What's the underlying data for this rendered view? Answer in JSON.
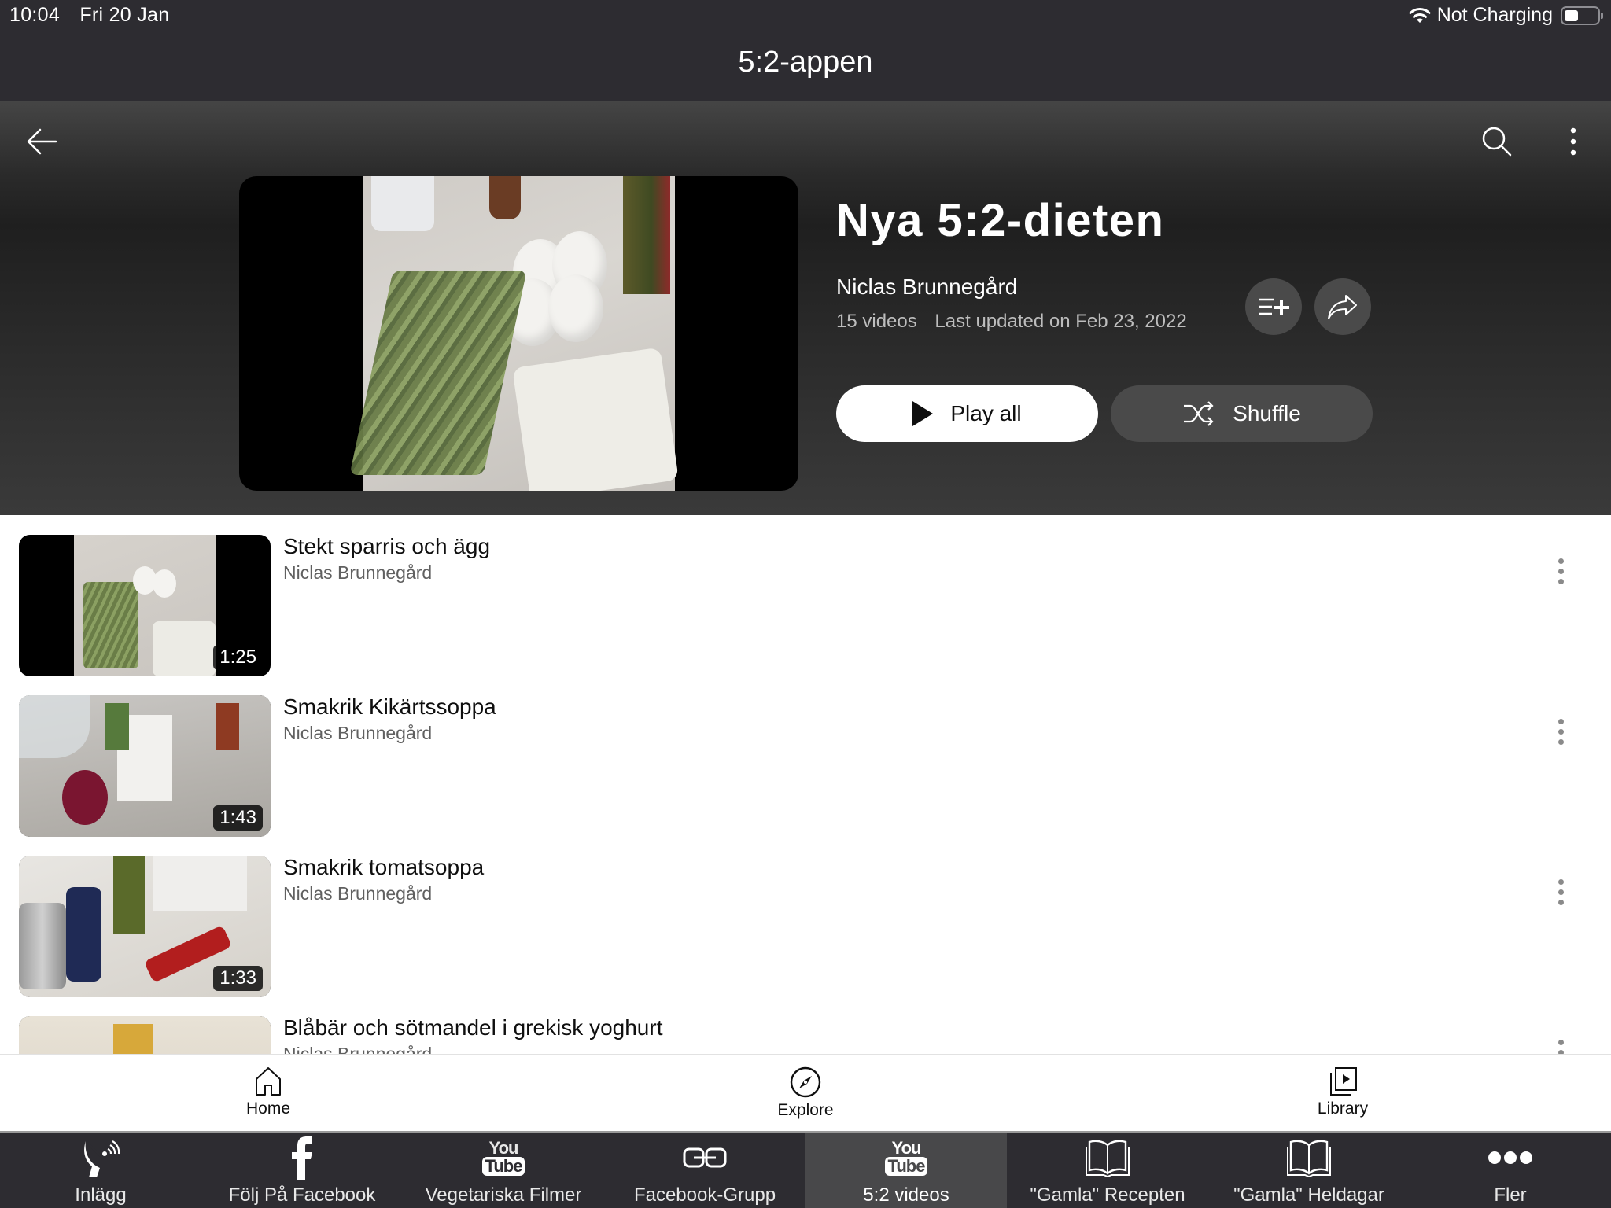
{
  "status_bar": {
    "time": "10:04",
    "date": "Fri 20 Jan",
    "charging": "Not Charging",
    "battery_level": 0.35
  },
  "app": {
    "title": "5:2-appen"
  },
  "header": {
    "back_icon": "arrow-left-icon",
    "search_icon": "search-icon",
    "more_icon": "more-vertical-icon"
  },
  "playlist": {
    "title": "Nya 5:2-dieten",
    "owner": "Niclas Brunnegård",
    "video_count": "15 videos",
    "last_updated": "Last updated on Feb 23, 2022",
    "save_icon": "playlist-add-icon",
    "share_icon": "share-icon",
    "play_all_label": "Play all",
    "shuffle_label": "Shuffle"
  },
  "videos": [
    {
      "title": "Stekt sparris och ägg",
      "channel": "Niclas Brunnegård",
      "duration": "1:25"
    },
    {
      "title": "Smakrik Kikärtssoppa",
      "channel": "Niclas Brunnegård",
      "duration": "1:43"
    },
    {
      "title": "Smakrik tomatsoppa",
      "channel": "Niclas Brunnegård",
      "duration": "1:33"
    },
    {
      "title": "Blåbär och sötmandel i grekisk yoghurt",
      "channel": "Niclas Brunnegård",
      "duration": ""
    }
  ],
  "youtube_nav": [
    {
      "label": "Home",
      "icon": "home-icon"
    },
    {
      "label": "Explore",
      "icon": "compass-icon"
    },
    {
      "label": "Library",
      "icon": "library-icon"
    }
  ],
  "tabs": [
    {
      "label": "Inlägg",
      "icon": "satellite-dish-icon",
      "active": false
    },
    {
      "label": "Följ På Facebook",
      "icon": "facebook-icon",
      "active": false
    },
    {
      "label": "Vegetariska Filmer",
      "icon": "youtube-icon",
      "active": false
    },
    {
      "label": "Facebook-Grupp",
      "icon": "link-icon",
      "active": false
    },
    {
      "label": "5:2 videos",
      "icon": "youtube-icon",
      "active": true
    },
    {
      "label": "\"Gamla\" Recepten",
      "icon": "book-icon",
      "active": false
    },
    {
      "label": "\"Gamla\" Heldagar",
      "icon": "book-icon",
      "active": false
    },
    {
      "label": "Fler",
      "icon": "more-horizontal-icon",
      "active": false
    }
  ],
  "yt_logo": {
    "you": "You",
    "tube": "Tube"
  }
}
